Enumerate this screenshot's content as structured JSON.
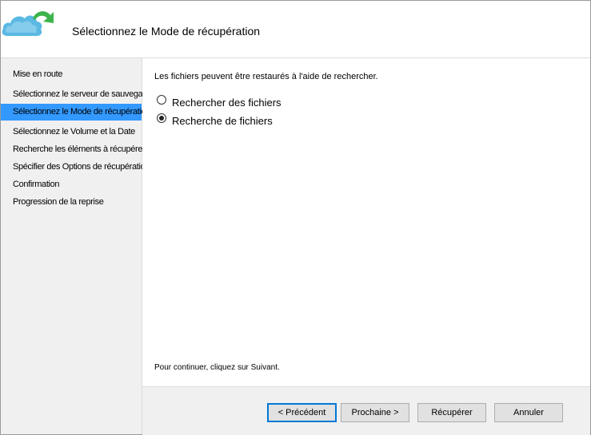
{
  "header": {
    "title": "Sélectionnez le Mode de récupération",
    "logo_icon": "cloud-arrow-icon",
    "colors": {
      "cloud": "#3fa9d9",
      "arrow": "#3cb44b"
    }
  },
  "sidebar": {
    "active_color": "#3399ff",
    "items": [
      {
        "label": "Mise en route"
      },
      {
        "label": "Sélectionnez le serveur de sauvegarde"
      },
      {
        "label": "Sélectionnez le Mode de récupération"
      },
      {
        "label": "Sélectionnez le Volume et la Date"
      },
      {
        "label": "Recherche les éléments à récupérer"
      },
      {
        "label": "Spécifier des Options de récupération"
      },
      {
        "label": "Confirmation"
      },
      {
        "label": "Progression de la reprise"
      }
    ]
  },
  "main": {
    "intro": "Les fichiers peuvent être restaurés à l'aide de rechercher.",
    "options": [
      {
        "label": "Rechercher des fichiers",
        "checked": false
      },
      {
        "label": "Recherche de fichiers",
        "checked": true
      }
    ],
    "hint": "Pour continuer, cliquez sur Suivant."
  },
  "footer": {
    "previous_label": "< Précédent",
    "next_label": "Prochaine >",
    "recover_label": "Récupérer",
    "cancel_label": "Annuler"
  }
}
